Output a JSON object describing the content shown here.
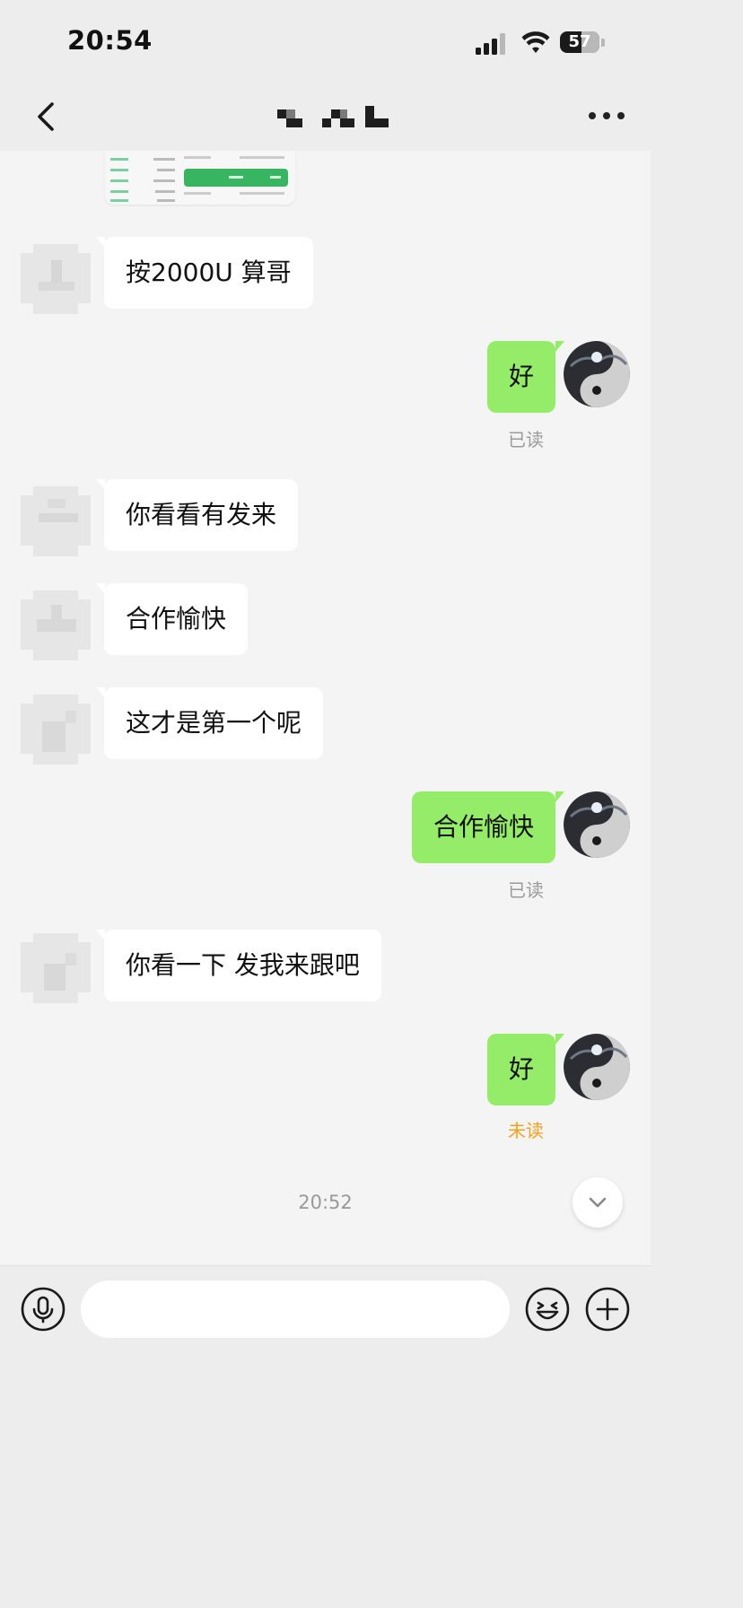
{
  "status_bar": {
    "time": "20:54",
    "battery_level": "57"
  },
  "nav": {
    "back_icon": "chevron-left-icon",
    "title": "",
    "more_icon": "ellipsis-icon"
  },
  "messages": [
    {
      "side": "left",
      "text": "按2000U 算哥"
    },
    {
      "side": "right",
      "text": "好",
      "receipt": "已读"
    },
    {
      "side": "left",
      "text": "你看看有发来"
    },
    {
      "side": "left",
      "text": "合作愉快"
    },
    {
      "side": "left",
      "text": "这才是第一个呢"
    },
    {
      "side": "right",
      "text": "合作愉快",
      "receipt": "已读"
    },
    {
      "side": "left",
      "text": "你看一下 发我来跟吧"
    },
    {
      "side": "right",
      "text": "好",
      "receipt": "未读"
    }
  ],
  "timestamp": "20:52",
  "input_bar": {
    "voice_icon": "microphone-icon",
    "placeholder": "",
    "emoji_icon": "smiley-icon",
    "plus_icon": "plus-circle-icon"
  },
  "colors": {
    "sent_bubble": "#95ec69",
    "received_bubble": "#ffffff",
    "unread_receipt": "#f0a020",
    "read_receipt": "#9a9a9a"
  }
}
